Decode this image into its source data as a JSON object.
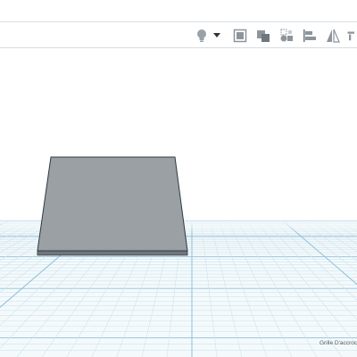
{
  "toolbar": {
    "buttons": [
      {
        "name": "light-bulb-icon"
      },
      {
        "name": "dropdown-arrow-icon"
      },
      {
        "name": "note-icon"
      },
      {
        "name": "group-icon"
      },
      {
        "name": "show-all-icon"
      },
      {
        "name": "align-icon"
      },
      {
        "name": "mirror-icon"
      },
      {
        "name": "cruise-icon"
      }
    ]
  },
  "workplane": {
    "grid_label": "Grille D'accroc"
  },
  "colors": {
    "shape_fill": "#9aa0a4",
    "shape_edge": "#2f3a44",
    "grid_fine": "#cfe3ec",
    "grid_major": "#8fc0d8",
    "toolbar_icon": "#8d959c"
  }
}
